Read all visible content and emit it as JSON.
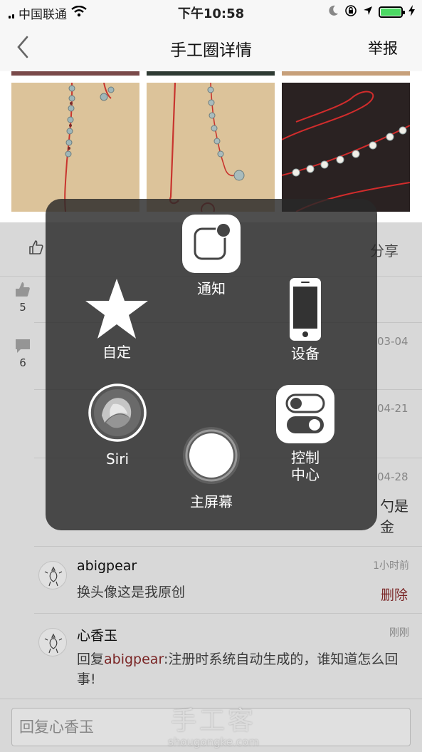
{
  "status_bar": {
    "carrier": "中国联通",
    "time": "下午10:58"
  },
  "nav": {
    "title": "手工圈详情",
    "report": "举报"
  },
  "actions": {
    "share": "分享"
  },
  "stats": {
    "likes": "5",
    "comments": "6"
  },
  "hidden_partials": {
    "date1": "03-04",
    "date2": "04-21",
    "date3": "04-28",
    "text_tail": "勺是金"
  },
  "comments": [
    {
      "user": "abigpear",
      "time": "1小时前",
      "text": "换头像这是我原创",
      "delete": "删除"
    },
    {
      "user": "心香玉",
      "time": "刚刚",
      "reply_prefix": "回复",
      "mention": "abigpear",
      "text": ":注册时系统自动生成的，谁知道怎么回事!"
    }
  ],
  "reply": {
    "placeholder": "回复心香玉"
  },
  "watermark": {
    "brand": "手工客",
    "domain": "shougongke.com"
  },
  "assistive_touch": {
    "notifications": "通知",
    "custom": "自定",
    "device": "设备",
    "siri": "Siri",
    "control_center_line1": "控制",
    "control_center_line2": "中心",
    "home": "主屏幕"
  }
}
